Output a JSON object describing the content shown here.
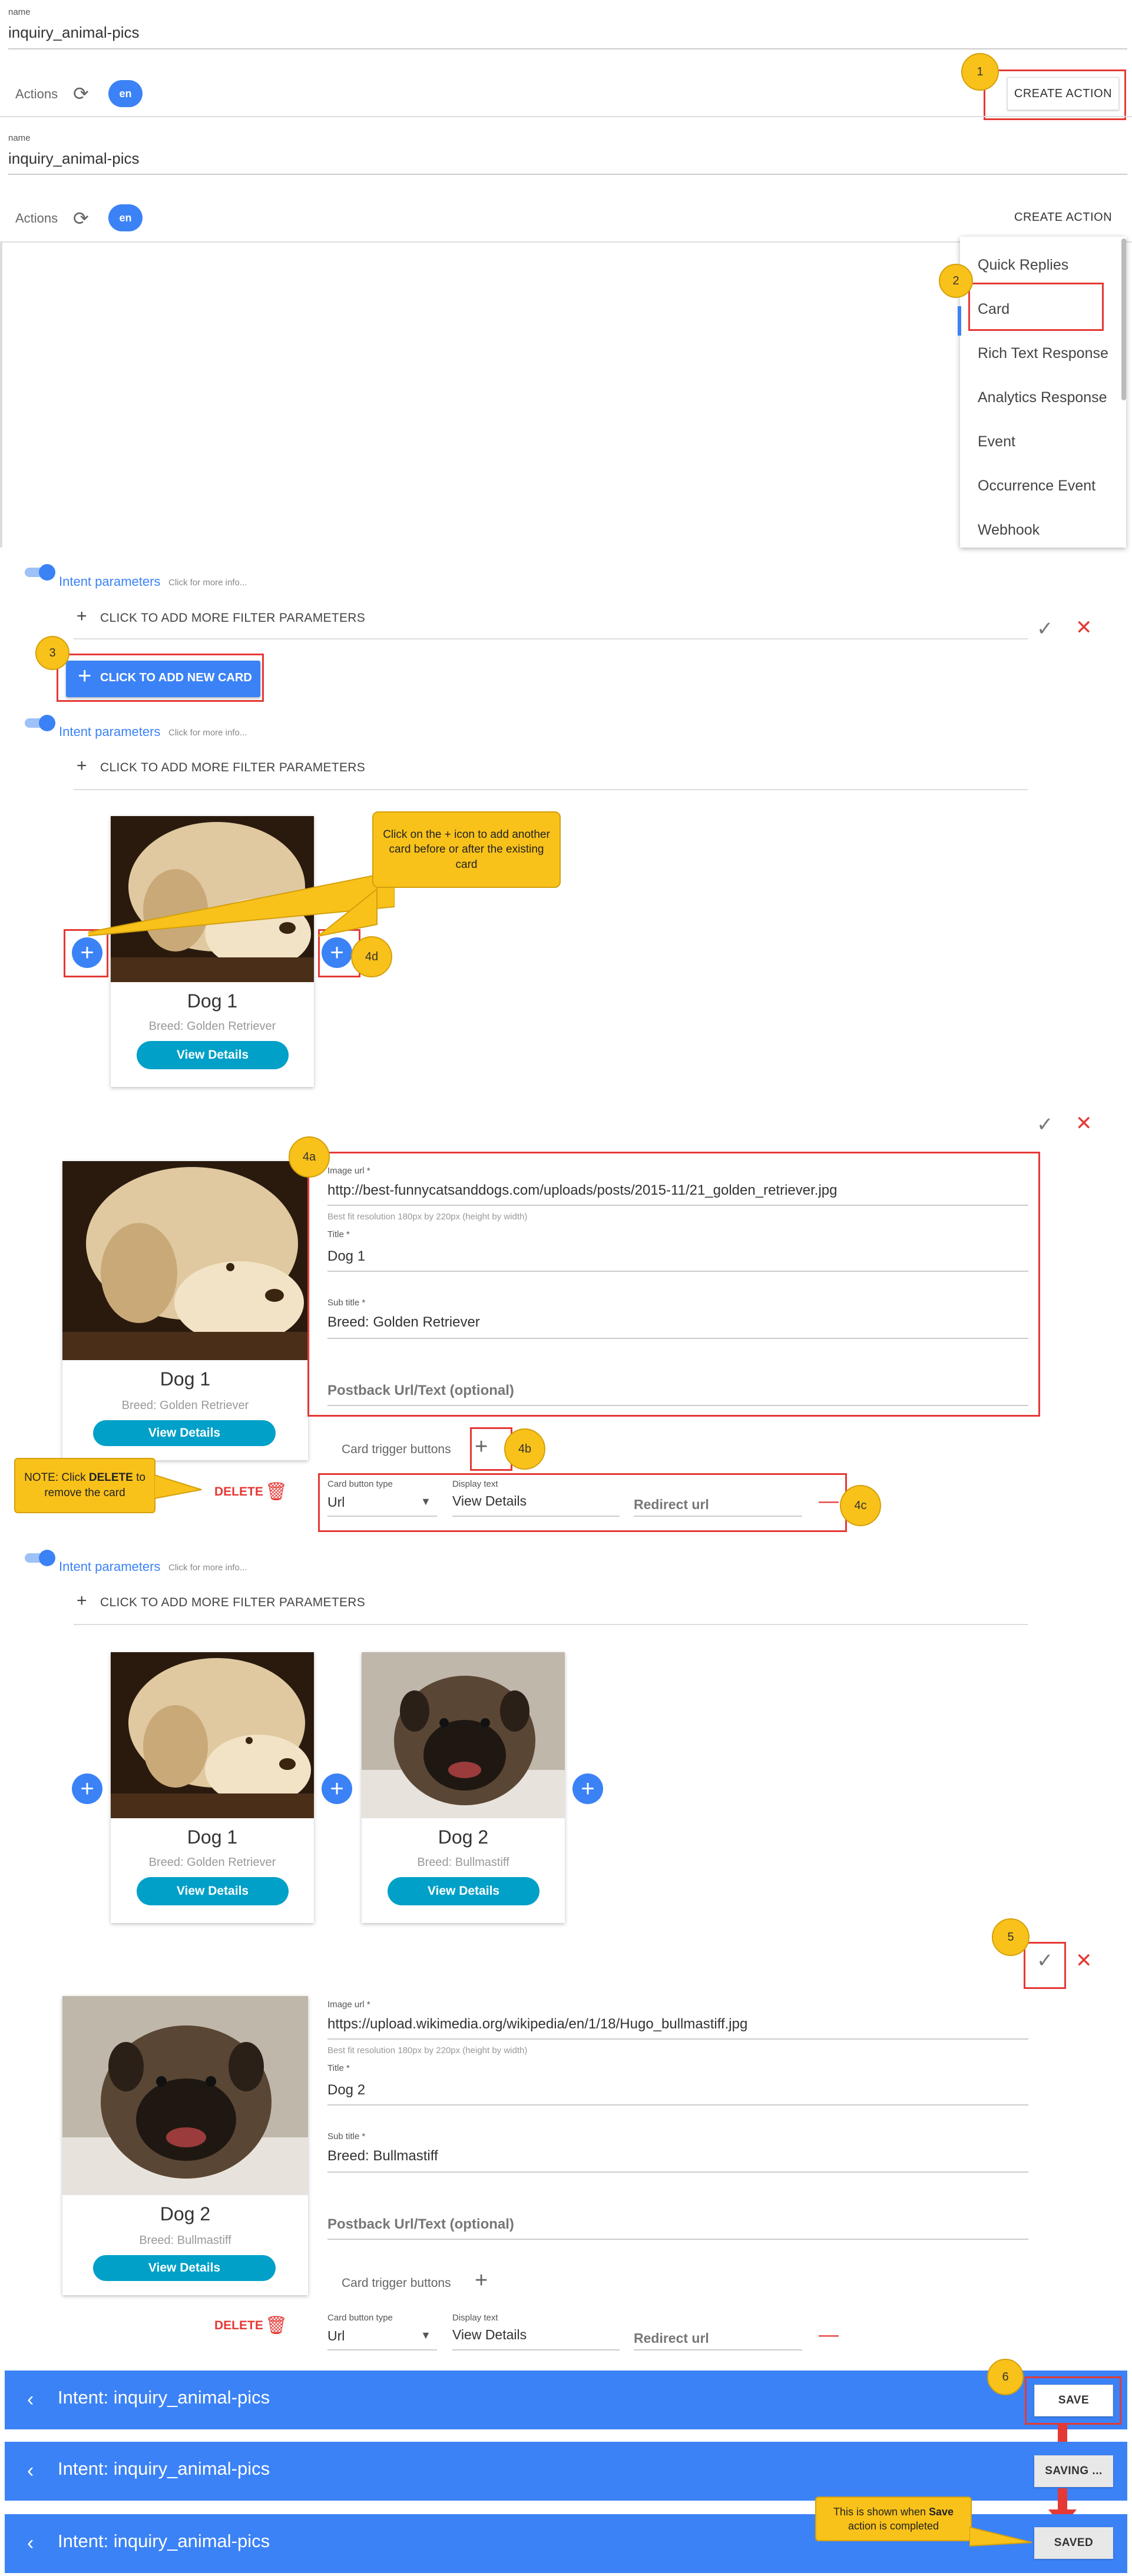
{
  "section1": {
    "name_label": "name",
    "name_value": "inquiry_animal-pics",
    "actions_label": "Actions",
    "lang": "en",
    "create_action": "CREATE ACTION",
    "marker": "1"
  },
  "section2": {
    "name_label": "name",
    "name_value": "inquiry_animal-pics",
    "actions_label": "Actions",
    "lang": "en",
    "create_action": "CREATE ACTION",
    "marker": "2",
    "menu": [
      "Quick Replies",
      "Card",
      "Rich Text Response",
      "Analytics Response",
      "Event",
      "Occurrence Event",
      "Webhook"
    ]
  },
  "intent_params": {
    "label": "Intent parameters",
    "hint": "Click for more info...",
    "filter": "CLICK TO ADD MORE FILTER PARAMETERS"
  },
  "add_card": {
    "marker": "3",
    "label": "CLICK TO ADD NEW CARD"
  },
  "callout_plus": "Click on the + icon to add another card before or after the existing card",
  "marker_4d": "4d",
  "marker_4a": "4a",
  "marker_4b": "4b",
  "marker_4c": "4c",
  "marker_5": "5",
  "marker_6": "6",
  "dog1": {
    "title": "Dog 1",
    "subtitle": "Breed: Golden Retriever",
    "button": "View Details"
  },
  "dog2": {
    "title": "Dog 2",
    "subtitle": "Breed: Bullmastiff",
    "button": "View Details"
  },
  "editor1": {
    "image_url_label": "Image url *",
    "image_url": "http://best-funnycatsanddogs.com/uploads/posts/2015-11/21_golden_retriever.jpg",
    "hint": "Best fit resolution 180px by 220px (height by width)",
    "title_label": "Title *",
    "title": "Dog 1",
    "sub_label": "Sub title *",
    "sub": "Breed: Golden Retriever",
    "postback": "Postback Url/Text (optional)",
    "trigger": "Card trigger buttons",
    "btn_type_label": "Card button type",
    "btn_type": "Url",
    "display_label": "Display text",
    "display": "View Details",
    "redirect": "Redirect url",
    "delete": "DELETE"
  },
  "editor2": {
    "image_url_label": "Image url *",
    "image_url": "https://upload.wikimedia.org/wikipedia/en/1/18/Hugo_bullmastiff.jpg",
    "hint": "Best fit resolution 180px by 220px (height by width)",
    "title_label": "Title *",
    "title": "Dog 2",
    "sub_label": "Sub title *",
    "sub": "Breed: Bullmastiff",
    "postback": "Postback Url/Text (optional)",
    "trigger": "Card trigger buttons",
    "btn_type_label": "Card button type",
    "btn_type": "Url",
    "display_label": "Display text",
    "display": "View Details",
    "redirect": "Redirect url",
    "delete": "DELETE"
  },
  "note_delete": {
    "prefix": "NOTE: Click ",
    "bold": "DELETE",
    "suffix": " to remove the card"
  },
  "bars": [
    {
      "title": "Intent: inquiry_animal-pics",
      "button": "SAVE"
    },
    {
      "title": "Intent: inquiry_animal-pics",
      "button": "SAVING ..."
    },
    {
      "title": "Intent: inquiry_animal-pics",
      "button": "SAVED"
    }
  ],
  "callout_saved": {
    "prefix": "This is shown when ",
    "bold": "Save",
    "suffix": " action is completed"
  },
  "colors": {
    "primary_blue": "#3b82f6",
    "marker_yellow": "#f9c21a",
    "highlight_red": "#e53935",
    "card_button": "#00a0c8"
  }
}
